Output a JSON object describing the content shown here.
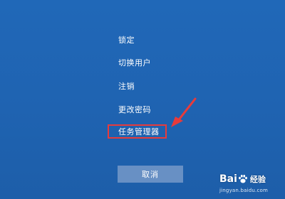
{
  "menu": {
    "items": [
      {
        "label": "锁定"
      },
      {
        "label": "切换用户"
      },
      {
        "label": "注销"
      },
      {
        "label": "更改密码"
      },
      {
        "label": "任务管理器",
        "highlighted": true
      }
    ],
    "cancel_label": "取消"
  },
  "annotation": {
    "highlight_color": "#e83b3b",
    "arrow_color": "#e83b3b"
  },
  "watermark": {
    "brand_left": "Bai",
    "brand_right": "经验",
    "url": "jingyan.baidu.com"
  },
  "colors": {
    "background": "#1f63b1",
    "cancel_button": "#6890c4",
    "text": "#ffffff"
  }
}
